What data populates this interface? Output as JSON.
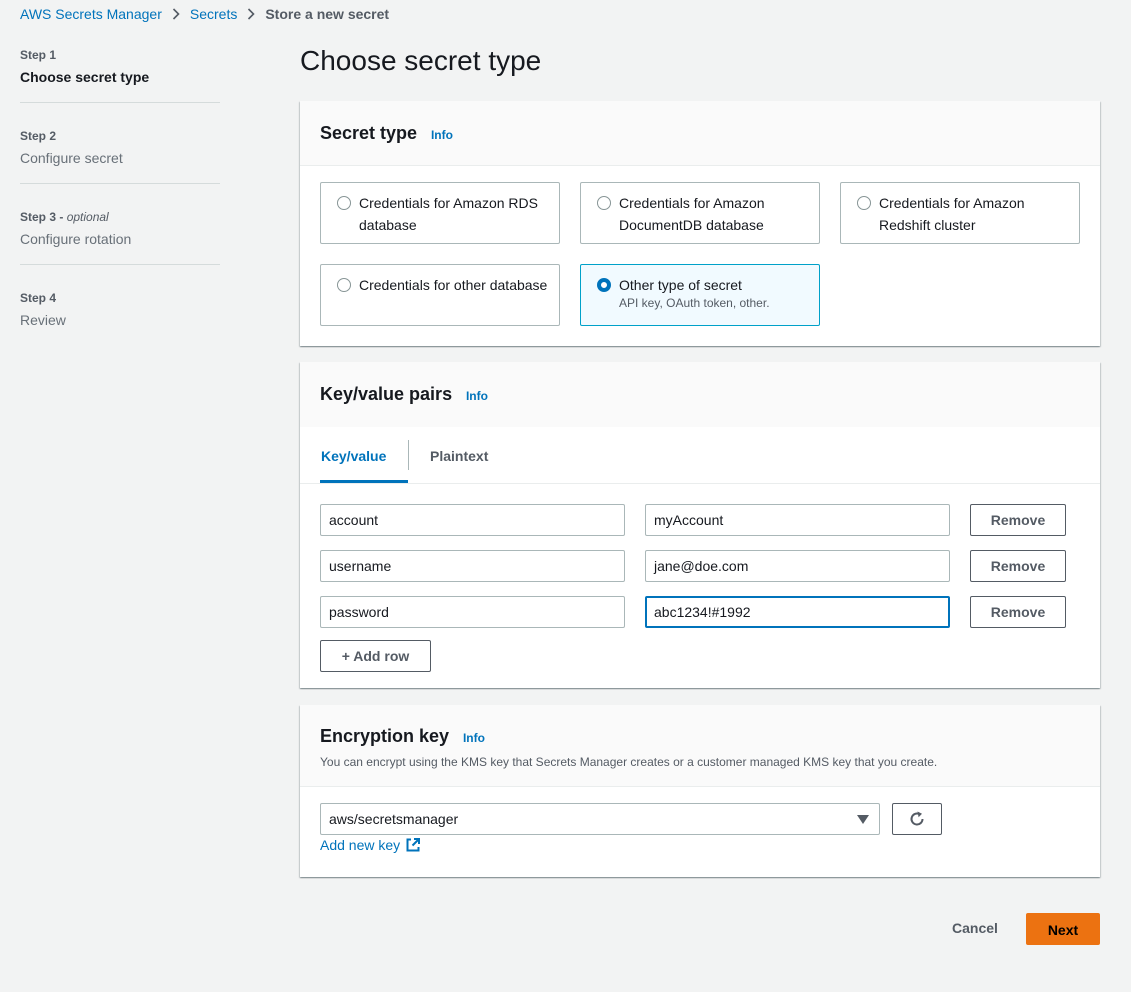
{
  "breadcrumb": {
    "items": [
      "AWS Secrets Manager",
      "Secrets"
    ],
    "current": "Store a new secret"
  },
  "steps": [
    {
      "num": "Step 1",
      "optional": "",
      "title": "Choose secret type",
      "active": true
    },
    {
      "num": "Step 2",
      "optional": "",
      "title": "Configure secret",
      "active": false
    },
    {
      "num": "Step 3",
      "optional": "optional",
      "title": "Configure rotation",
      "active": false
    },
    {
      "num": "Step 4",
      "optional": "",
      "title": "Review",
      "active": false
    }
  ],
  "page_title": "Choose secret type",
  "secret_type": {
    "header": "Secret type",
    "info": "Info",
    "options": [
      {
        "label": "Credentials for Amazon RDS database",
        "desc": "",
        "selected": false
      },
      {
        "label": "Credentials for Amazon DocumentDB database",
        "desc": "",
        "selected": false
      },
      {
        "label": "Credentials for Amazon Redshift cluster",
        "desc": "",
        "selected": false
      },
      {
        "label": "Credentials for other database",
        "desc": "",
        "selected": false
      },
      {
        "label": "Other type of secret",
        "desc": "API key, OAuth token, other.",
        "selected": true
      }
    ]
  },
  "kv": {
    "header": "Key/value pairs",
    "info": "Info",
    "tabs": [
      "Key/value",
      "Plaintext"
    ],
    "rows": [
      {
        "key": "account",
        "value": "myAccount"
      },
      {
        "key": "username",
        "value": "jane@doe.com"
      },
      {
        "key": "password",
        "value": "abc1234!#1992"
      }
    ],
    "remove_label": "Remove",
    "add_row_label": "+ Add row"
  },
  "encryption": {
    "header": "Encryption key",
    "info": "Info",
    "description": "You can encrypt using the KMS key that Secrets Manager creates or a customer managed KMS key that you create.",
    "selected_key": "aws/secretsmanager",
    "add_key_label": "Add new key"
  },
  "footer": {
    "cancel": "Cancel",
    "next": "Next"
  },
  "colors": {
    "link": "#0073bb",
    "primary_button": "#ec7211",
    "selected_tile_bg": "#f1faff"
  }
}
